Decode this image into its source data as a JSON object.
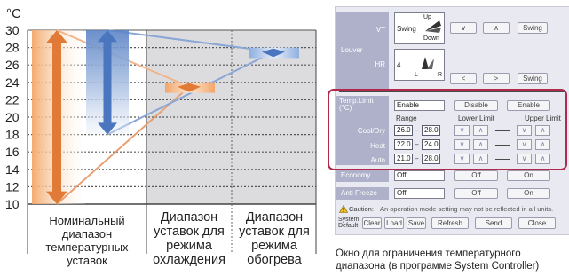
{
  "diagram": {
    "y_unit": "°C",
    "y_ticks": [
      "30",
      "28",
      "26",
      "24",
      "22",
      "20",
      "18",
      "16",
      "14",
      "12",
      "10"
    ],
    "columns": [
      {
        "label": "Номинальный диапазон температурных уставок"
      },
      {
        "label": "Диапазон уставок для режима охлаждения"
      },
      {
        "label": "Диапазон уставок для режима обогрева"
      }
    ],
    "chart_data": {
      "type": "range",
      "y_min": 10,
      "y_max": 30,
      "ranges": [
        {
          "low": 10,
          "high": 30,
          "color": "#e07a36"
        },
        {
          "low": 18,
          "high": 30,
          "color": "#4a76c0"
        },
        {
          "low": 23,
          "high": 24,
          "color": "#e07a36"
        },
        {
          "low": 27,
          "high": 28,
          "color": "#4a76c0"
        }
      ]
    },
    "colors": {
      "orange": "#e07a36",
      "blue": "#4a76c0",
      "grid_bg": "#dcdcde"
    }
  },
  "panel": {
    "louver": {
      "section_label": "Louver",
      "vt_label": "VT",
      "vt_value": "Swing",
      "vt_up": "Up",
      "vt_down": "Down",
      "hr_label": "HR",
      "hr_value": "4",
      "hr_l": "L",
      "hr_r": "R",
      "btn_down": "∨",
      "btn_up": "∧",
      "btn_left": "<",
      "btn_right": ">",
      "btn_swing": "Swing",
      "btn_swing2": "Swing"
    },
    "temp_limit": {
      "label": "Temp.Limit (°C)",
      "value": "Enable",
      "disable": "Disable",
      "enable": "Enable",
      "range_header": "Range",
      "lower_header": "Lower Limit",
      "upper_header": "Upper Limit",
      "rows": [
        {
          "mode": "Cool/Dry",
          "low": "26.0",
          "high": "28.0"
        },
        {
          "mode": "Heat",
          "low": "22.0",
          "high": "24.0"
        },
        {
          "mode": "Auto",
          "low": "21.0",
          "high": "28.0"
        }
      ],
      "dash": "–",
      "arrow_down": "∨",
      "arrow_up": "∧"
    },
    "economy": {
      "label": "Economy",
      "value": "Off",
      "off": "Off",
      "on": "On"
    },
    "anti_freeze": {
      "label": "Anti Freeze",
      "value": "Off",
      "off": "Off",
      "on": "On"
    },
    "caution": {
      "label": "Caution:",
      "text": "An operation mode setting may not be reflected in all units."
    },
    "footer": {
      "system_default": "System Default",
      "clear": "Clear",
      "load": "Load",
      "save": "Save",
      "refresh": "Refresh",
      "send": "Send",
      "close": "Close"
    }
  },
  "caption": "Окно для ограничения температурного диапазона (в программе System Controller)"
}
